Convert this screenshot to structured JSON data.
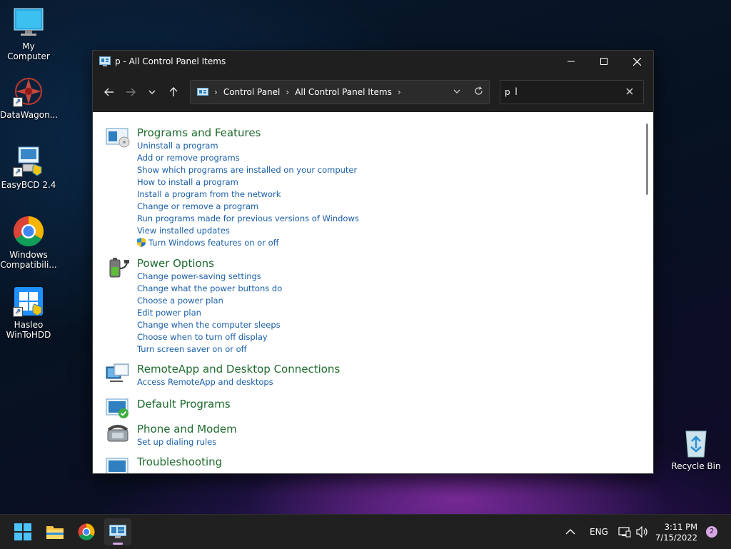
{
  "desktop": {
    "icons": [
      {
        "label": "My Computer"
      },
      {
        "label": "DataWagon..."
      },
      {
        "label": "EasyBCD 2.4"
      },
      {
        "label": "Windows\nCompatibili..."
      },
      {
        "label": "Hasleo\nWinToHDD"
      },
      {
        "label": "Recycle Bin"
      }
    ]
  },
  "window": {
    "title": "p - All Control Panel Items",
    "address": {
      "crumbs": [
        "Control Panel",
        "All Control Panel Items"
      ]
    },
    "search": {
      "value": "p"
    },
    "groups": [
      {
        "heading": "Programs and Features",
        "links": [
          "Uninstall a program",
          "Add or remove programs",
          "Show which programs are installed on your computer",
          "How to install a program",
          "Install a program from the network",
          "Change or remove a program",
          "Run programs made for previous versions of Windows",
          "View installed updates",
          "Turn Windows features on or off"
        ]
      },
      {
        "heading": "Power Options",
        "links": [
          "Change power-saving settings",
          "Change what the power buttons do",
          "Choose a power plan",
          "Edit power plan",
          "Change when the computer sleeps",
          "Choose when to turn off display",
          "Turn screen saver on or off"
        ]
      },
      {
        "heading": "RemoteApp and Desktop Connections",
        "links": [
          "Access RemoteApp and desktops"
        ]
      },
      {
        "heading": "Default Programs",
        "links": []
      },
      {
        "heading": "Phone and Modem",
        "links": [
          "Set up dialing rules"
        ]
      },
      {
        "heading": "Troubleshooting",
        "links": []
      }
    ]
  },
  "taskbar": {
    "language": "ENG",
    "time": "3:11 PM",
    "date": "7/15/2022",
    "notifications": "2"
  },
  "colors": {
    "heading": "#1e6a2e",
    "link": "#1a5fa8",
    "accent": "#d8a5e6"
  }
}
